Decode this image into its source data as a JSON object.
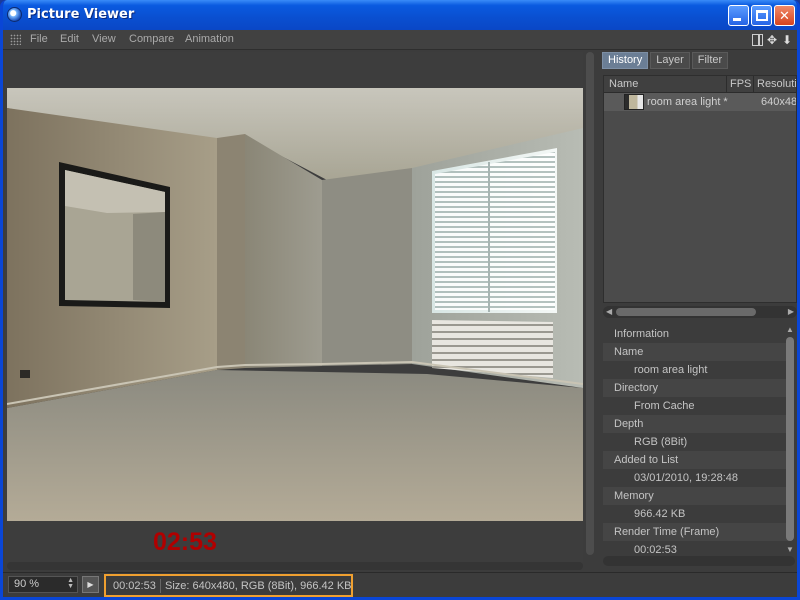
{
  "window": {
    "title": "Picture Viewer"
  },
  "menu": {
    "items": [
      "File",
      "Edit",
      "View",
      "Compare",
      "Animation"
    ]
  },
  "viewer": {
    "timecode": "02:53"
  },
  "tabs": [
    "History",
    "Layer",
    "Filter"
  ],
  "history": {
    "columns": [
      "Name",
      "FPS",
      "Resoluti"
    ],
    "rows": [
      {
        "name": "room area light *",
        "resolution": "640x48"
      }
    ]
  },
  "info": {
    "header": "Information",
    "fields": [
      {
        "label": "Name",
        "value": "room area light"
      },
      {
        "label": "Directory",
        "value": "From Cache"
      },
      {
        "label": "Depth",
        "value": "RGB (8Bit)"
      },
      {
        "label": "Added to List",
        "value": "03/01/2010, 19:28:48"
      },
      {
        "label": "Memory",
        "value": "966.42 KB"
      },
      {
        "label": "Render Time (Frame)",
        "value": "00:02:53"
      }
    ]
  },
  "statusbar": {
    "zoom": "90 %",
    "time": "00:02:53",
    "info": "Size: 640x480, RGB (8Bit), 966.42 KB"
  },
  "colors": {
    "titlebar": "#0a4fd0",
    "panel_bg": "#3c3c3c",
    "timecode": "#b00000",
    "status_highlight": "#f0a030",
    "tab_active": "#6b7e95"
  },
  "icons": {
    "app": "cinema4d-sphere-icon",
    "minimize": "minimize-icon",
    "maximize": "maximize-icon",
    "close": "close-icon",
    "play": "play-icon"
  }
}
